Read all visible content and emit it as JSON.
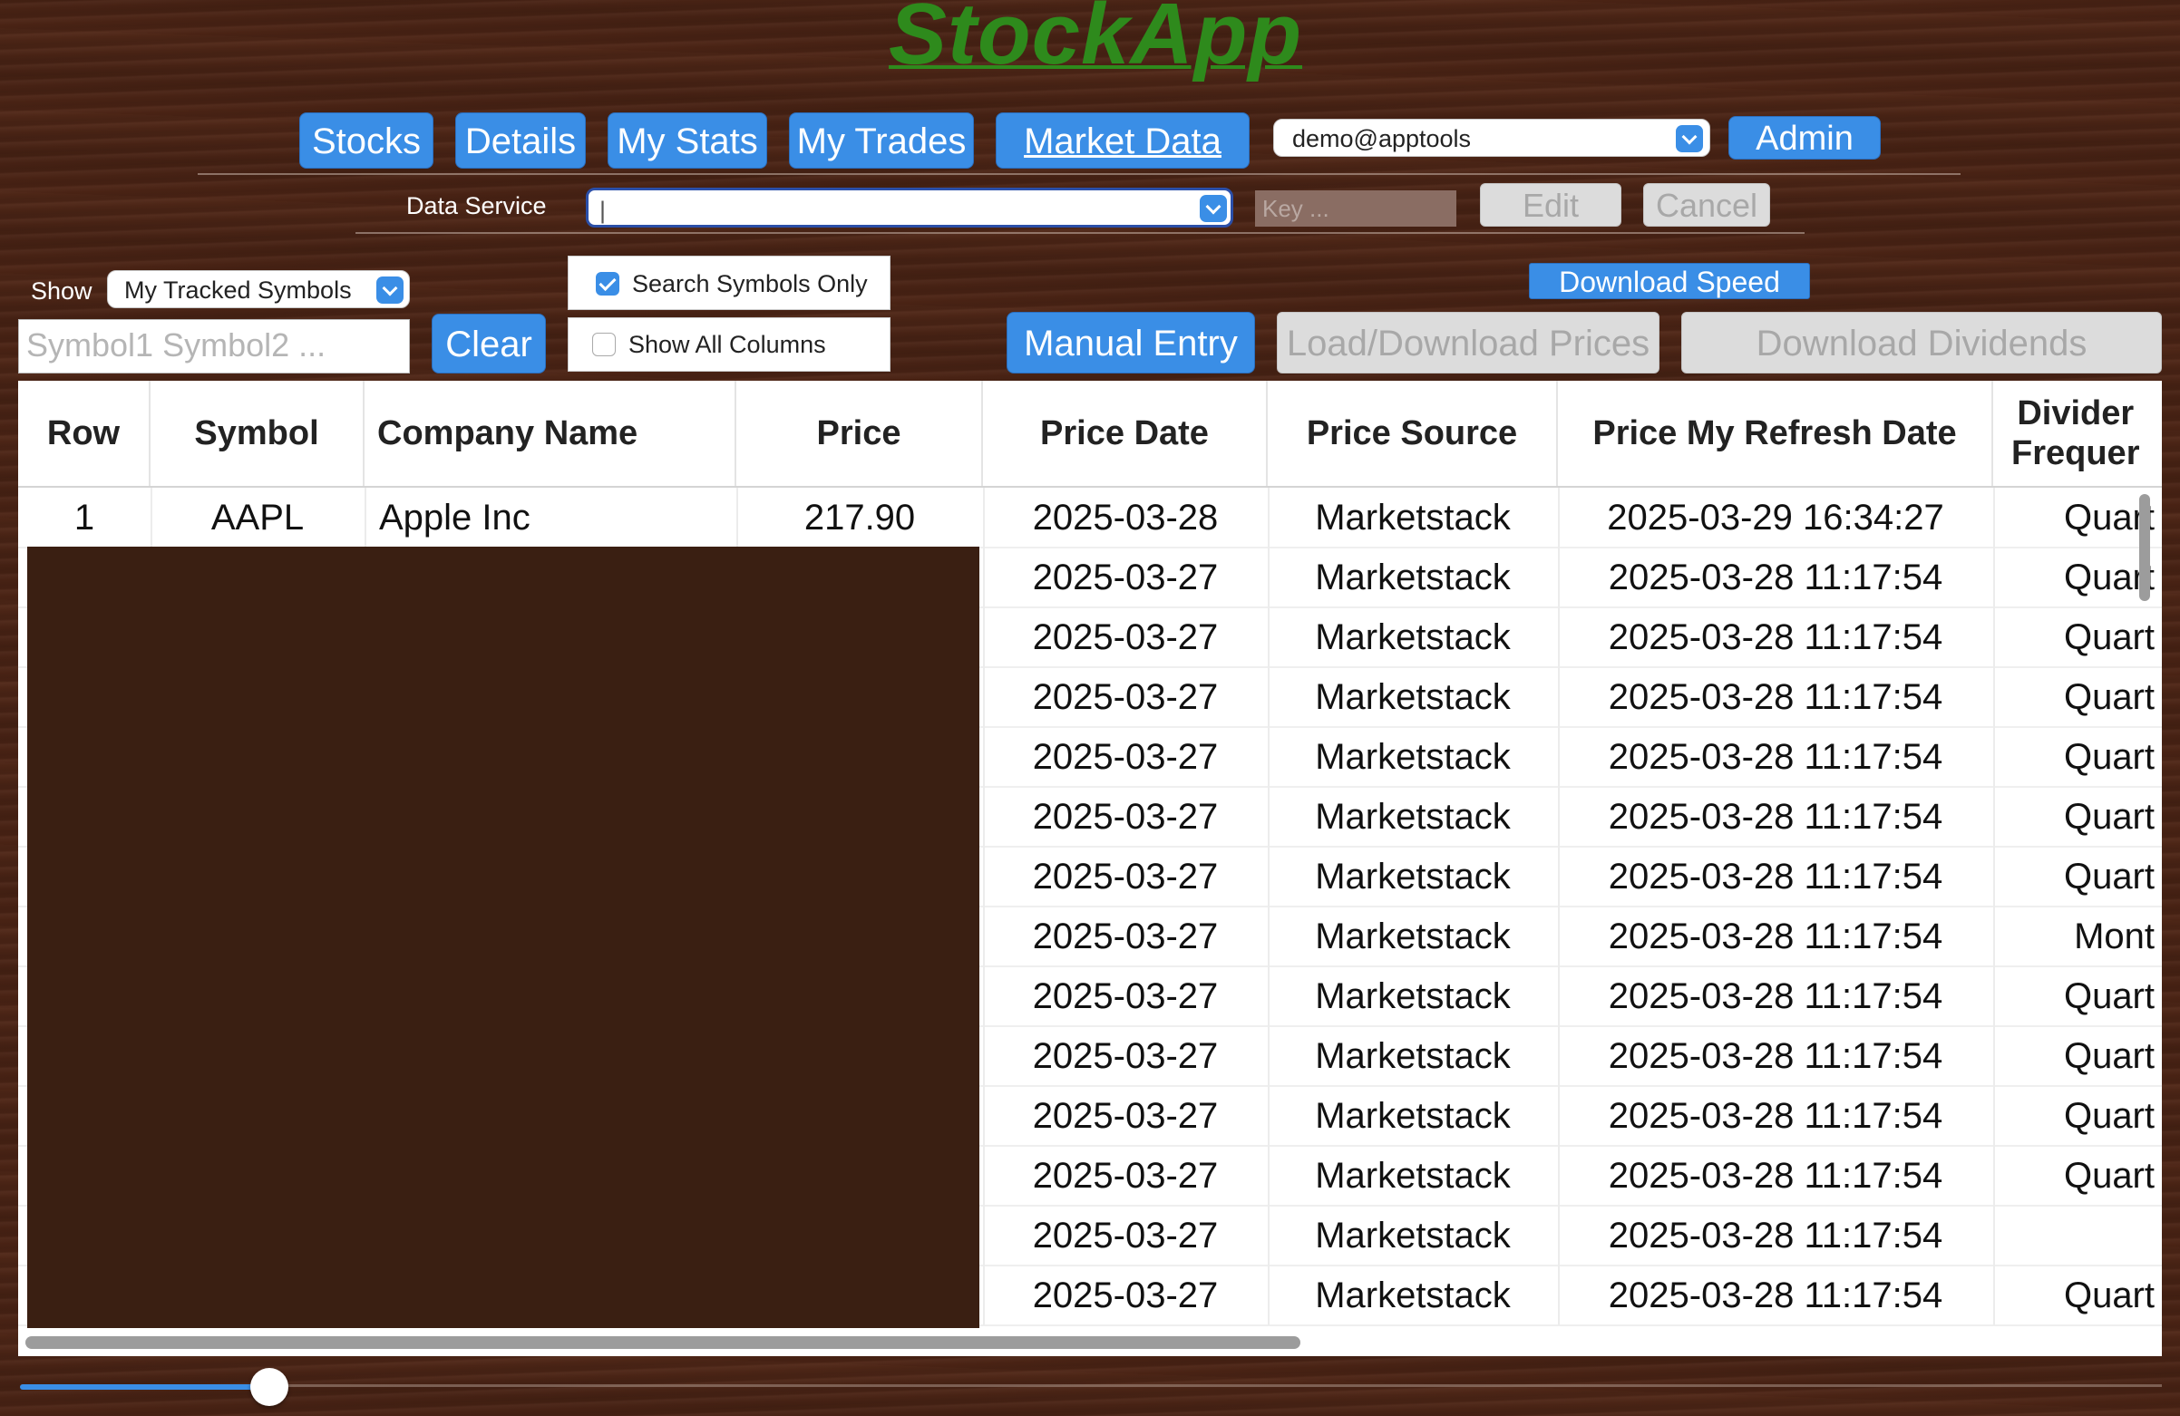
{
  "app": {
    "title": "StockApp"
  },
  "nav": {
    "tabs": [
      {
        "label": "Stocks"
      },
      {
        "label": "Details"
      },
      {
        "label": "My Stats"
      },
      {
        "label": "My Trades"
      },
      {
        "label": "Market Data",
        "active": true
      }
    ],
    "user_select": "demo@apptools",
    "admin_label": "Admin"
  },
  "data_service": {
    "label": "Data Service",
    "value": "|",
    "key_placeholder": "Key ...",
    "edit_label": "Edit",
    "cancel_label": "Cancel"
  },
  "filters": {
    "show_label": "Show",
    "show_value": "My Tracked Symbols",
    "symbols_placeholder": "Symbol1 Symbol2 ...",
    "clear_label": "Clear",
    "search_symbols_only": {
      "label": "Search Symbols Only",
      "checked": true
    },
    "show_all_columns": {
      "label": "Show All Columns",
      "checked": false
    }
  },
  "actions": {
    "download_speed_label": "Download Speed",
    "manual_entry_label": "Manual Entry",
    "load_download_prices_label": "Load/Download Prices",
    "download_dividends_label": "Download Dividends"
  },
  "table": {
    "columns": [
      "Row",
      "Symbol",
      "Company Name",
      "Price",
      "Price Date",
      "Price Source",
      "Price My Refresh Date",
      "Divider\nFrequer"
    ],
    "rows": [
      {
        "row": "1",
        "symbol": "AAPL",
        "company": "Apple Inc",
        "price": "217.90",
        "date": "2025-03-28",
        "source": "Marketstack",
        "refresh": "2025-03-29 16:34:27",
        "freq": "Quart"
      },
      {
        "row": "",
        "symbol": "",
        "company": "",
        "price": "",
        "date": "2025-03-27",
        "source": "Marketstack",
        "refresh": "2025-03-28 11:17:54",
        "freq": "Quart"
      },
      {
        "row": "",
        "symbol": "",
        "company": "",
        "price": "",
        "date": "2025-03-27",
        "source": "Marketstack",
        "refresh": "2025-03-28 11:17:54",
        "freq": "Quart"
      },
      {
        "row": "",
        "symbol": "",
        "company": "",
        "price": "",
        "date": "2025-03-27",
        "source": "Marketstack",
        "refresh": "2025-03-28 11:17:54",
        "freq": "Quart"
      },
      {
        "row": "",
        "symbol": "",
        "company": "",
        "price": "",
        "date": "2025-03-27",
        "source": "Marketstack",
        "refresh": "2025-03-28 11:17:54",
        "freq": "Quart"
      },
      {
        "row": "",
        "symbol": "",
        "company": "",
        "price": "",
        "date": "2025-03-27",
        "source": "Marketstack",
        "refresh": "2025-03-28 11:17:54",
        "freq": "Quart"
      },
      {
        "row": "",
        "symbol": "",
        "company": "",
        "price": "",
        "date": "2025-03-27",
        "source": "Marketstack",
        "refresh": "2025-03-28 11:17:54",
        "freq": "Quart"
      },
      {
        "row": "",
        "symbol": "",
        "company": "",
        "price": "",
        "date": "2025-03-27",
        "source": "Marketstack",
        "refresh": "2025-03-28 11:17:54",
        "freq": "Mont"
      },
      {
        "row": "",
        "symbol": "",
        "company": "",
        "price": "",
        "date": "2025-03-27",
        "source": "Marketstack",
        "refresh": "2025-03-28 11:17:54",
        "freq": "Quart"
      },
      {
        "row": "",
        "symbol": "",
        "company": "",
        "price": "",
        "date": "2025-03-27",
        "source": "Marketstack",
        "refresh": "2025-03-28 11:17:54",
        "freq": "Quart"
      },
      {
        "row": "",
        "symbol": "",
        "company": "",
        "price": "",
        "date": "2025-03-27",
        "source": "Marketstack",
        "refresh": "2025-03-28 11:17:54",
        "freq": "Quart"
      },
      {
        "row": "",
        "symbol": "",
        "company": "",
        "price": "",
        "date": "2025-03-27",
        "source": "Marketstack",
        "refresh": "2025-03-28 11:17:54",
        "freq": "Quart"
      },
      {
        "row": "",
        "symbol": "",
        "company": "",
        "price": "",
        "date": "2025-03-27",
        "source": "Marketstack",
        "refresh": "2025-03-28 11:17:54",
        "freq": ""
      },
      {
        "row": "",
        "symbol": "",
        "company": "",
        "price": "",
        "date": "2025-03-27",
        "source": "Marketstack",
        "refresh": "2025-03-28 11:17:54",
        "freq": "Quart"
      }
    ]
  },
  "zoom_slider": {
    "value": 0.13
  },
  "colors": {
    "accent": "#3a8ee6",
    "logo": "#2e8a1c",
    "background": "#4a2416"
  }
}
